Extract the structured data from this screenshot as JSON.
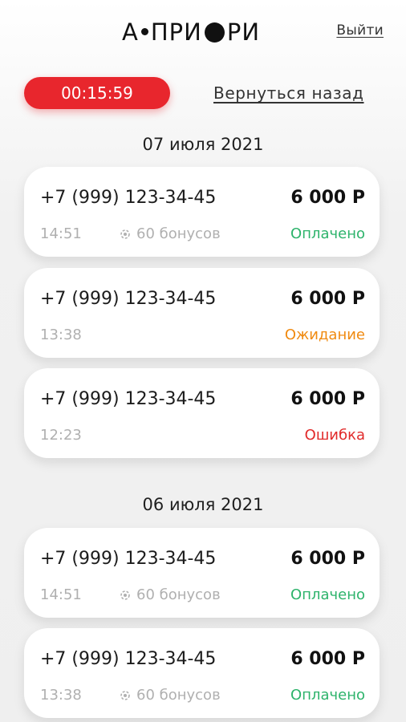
{
  "header": {
    "logo_parts": [
      "А",
      "ПРИ",
      "Р",
      "И"
    ],
    "logout_label": "Выйти"
  },
  "timer": {
    "value": "00:15:59"
  },
  "back_label": "Вернуться назад",
  "groups": [
    {
      "date": "07 июля 2021",
      "transactions": [
        {
          "phone": "+7 (999) 123-34-45",
          "amount": "6 000 Р",
          "time": "14:51",
          "bonus": "60 бонусов",
          "status": "Оплачено",
          "status_color": "#2db36b"
        },
        {
          "phone": "+7 (999) 123-34-45",
          "amount": "6 000 Р",
          "time": "13:38",
          "bonus": "",
          "status": "Ожидание",
          "status_color": "#f08a10"
        },
        {
          "phone": "+7 (999) 123-34-45",
          "amount": "6 000 Р",
          "time": "12:23",
          "bonus": "",
          "status": "Ошибка",
          "status_color": "#e12a2a"
        }
      ]
    },
    {
      "date": "06 июля 2021",
      "transactions": [
        {
          "phone": "+7 (999) 123-34-45",
          "amount": "6 000 Р",
          "time": "14:51",
          "bonus": "60 бонусов",
          "status": "Оплачено",
          "status_color": "#2db36b"
        },
        {
          "phone": "+7 (999) 123-34-45",
          "amount": "6 000 Р",
          "time": "13:38",
          "bonus": "60 бонусов",
          "status": "Оплачено",
          "status_color": "#2db36b"
        }
      ]
    }
  ],
  "colors": {
    "accent": "#e8262d",
    "paid": "#2db36b",
    "pending": "#f08a10",
    "error": "#e12a2a"
  }
}
